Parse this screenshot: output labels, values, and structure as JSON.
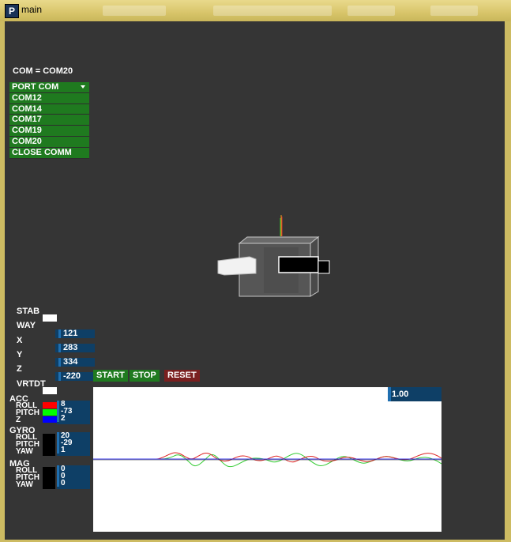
{
  "window": {
    "title": "main",
    "icon_letter": "P"
  },
  "com_status": "COM = COM20",
  "port_menu": {
    "header": "PORT COM",
    "items": [
      "COM12",
      "COM14",
      "COM17",
      "COM19",
      "COM20"
    ],
    "close": "CLOSE COMM"
  },
  "controls": {
    "stab_label": "STAB",
    "way_label": "WAY",
    "x_label": "X",
    "x_value": "121",
    "y_label": "Y",
    "y_value": "283",
    "y2_value": "334",
    "z_label": "Z",
    "z_value": "-220",
    "vrtdt_label": "VRTDT",
    "start": "START",
    "stop": "STOP",
    "reset": "RESET"
  },
  "acc": {
    "title": "ACC",
    "labels": [
      "ROLL",
      "PITCH",
      "Z"
    ],
    "values": [
      "8",
      "-73",
      "2"
    ],
    "colors": [
      "#ff0000",
      "#00ff00",
      "#0000ff"
    ]
  },
  "gyro": {
    "title": "GYRO",
    "labels": [
      "ROLL",
      "PITCH",
      "YAW"
    ],
    "values": [
      "20",
      "-29",
      "1"
    ]
  },
  "mag": {
    "title": "MAG",
    "labels": [
      "ROLL",
      "PITCH",
      "YAW"
    ],
    "values": [
      "0",
      "0",
      "0"
    ]
  },
  "plot": {
    "scale_value": "1.00"
  }
}
